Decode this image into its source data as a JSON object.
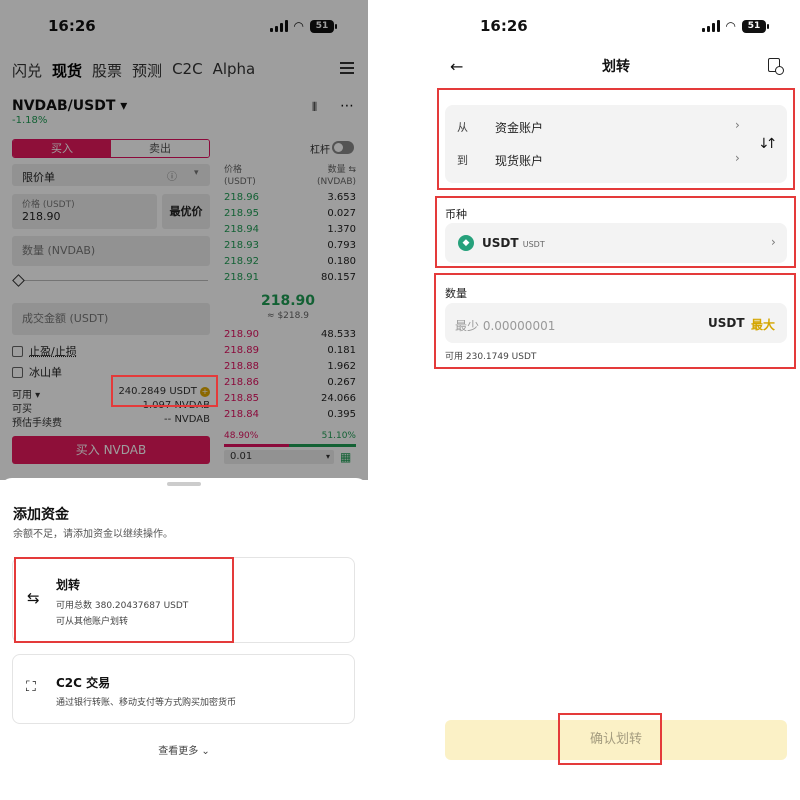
{
  "left": {
    "status": {
      "time": "16:26",
      "battery": "51"
    },
    "nav_tabs": [
      "闪兑",
      "现货",
      "股票",
      "预测",
      "C2C",
      "Alpha"
    ],
    "pair": "NVDAB/USDT ▾",
    "change": "-1.18%",
    "side_tabs": {
      "buy": "买入",
      "sell": "卖出"
    },
    "leverage_label": "杠杆",
    "order_type": "限价单",
    "price_label": "价格 (USDT)",
    "price_value": "218.90",
    "best_price": "最优价",
    "quantity_placeholder": "数量 (NVDAB)",
    "amount_placeholder": "成交金额 (USDT)",
    "tp_sl": "止盈/止损",
    "iceberg": "冰山单",
    "available_label": "可用 ▾",
    "available_value": "240.2849 USDT",
    "can_buy_label": "可买",
    "can_buy_value": "1.097 NVDAB",
    "fee_label": "预估手续费",
    "fee_value": "-- NVDAB",
    "buy_button": "买入 NVDAB",
    "orderbook": {
      "price_header": "价格\n(USDT)",
      "qty_header": "数量 ⇆\n(NVDAB)",
      "asks_top": [
        [
          "218.96",
          "3.653"
        ],
        [
          "218.95",
          "0.027"
        ],
        [
          "218.94",
          "1.370"
        ],
        [
          "218.93",
          "0.793"
        ],
        [
          "218.92",
          "0.180"
        ],
        [
          "218.91",
          "80.157"
        ]
      ],
      "mid_price": "218.90",
      "mid_sub": "≈ $218.9",
      "bids": [
        [
          "218.90",
          "48.533"
        ],
        [
          "218.89",
          "0.181"
        ],
        [
          "218.88",
          "1.962"
        ],
        [
          "218.86",
          "0.267"
        ],
        [
          "218.85",
          "24.066"
        ],
        [
          "218.84",
          "0.395"
        ]
      ],
      "buy_ratio": "48.90%",
      "sell_ratio": "51.10%",
      "depth": "0.01"
    },
    "sheet": {
      "title": "添加资金",
      "subtitle": "余额不足，请添加资金以继续操作。",
      "transfer": {
        "title": "划转",
        "line1": "可用总数 380.20437687 USDT",
        "line2": "可从其他账户划转"
      },
      "c2c": {
        "title": "C2C 交易",
        "line1": "通过银行转账、移动支付等方式购买加密货币"
      },
      "see_more": "查看更多"
    }
  },
  "right": {
    "status": {
      "time": "16:26",
      "battery": "51"
    },
    "title": "划转",
    "from_label": "从",
    "from_value": "资金账户",
    "to_label": "到",
    "to_value": "现货账户",
    "currency_section": "币种",
    "currency": "USDT",
    "currency_sub": "USDT",
    "amount_section": "数量",
    "amount_placeholder": "最少 0.00000001",
    "amount_unit": "USDT",
    "max": "最大",
    "available": "可用 230.1749 USDT",
    "confirm": "确认划转"
  }
}
